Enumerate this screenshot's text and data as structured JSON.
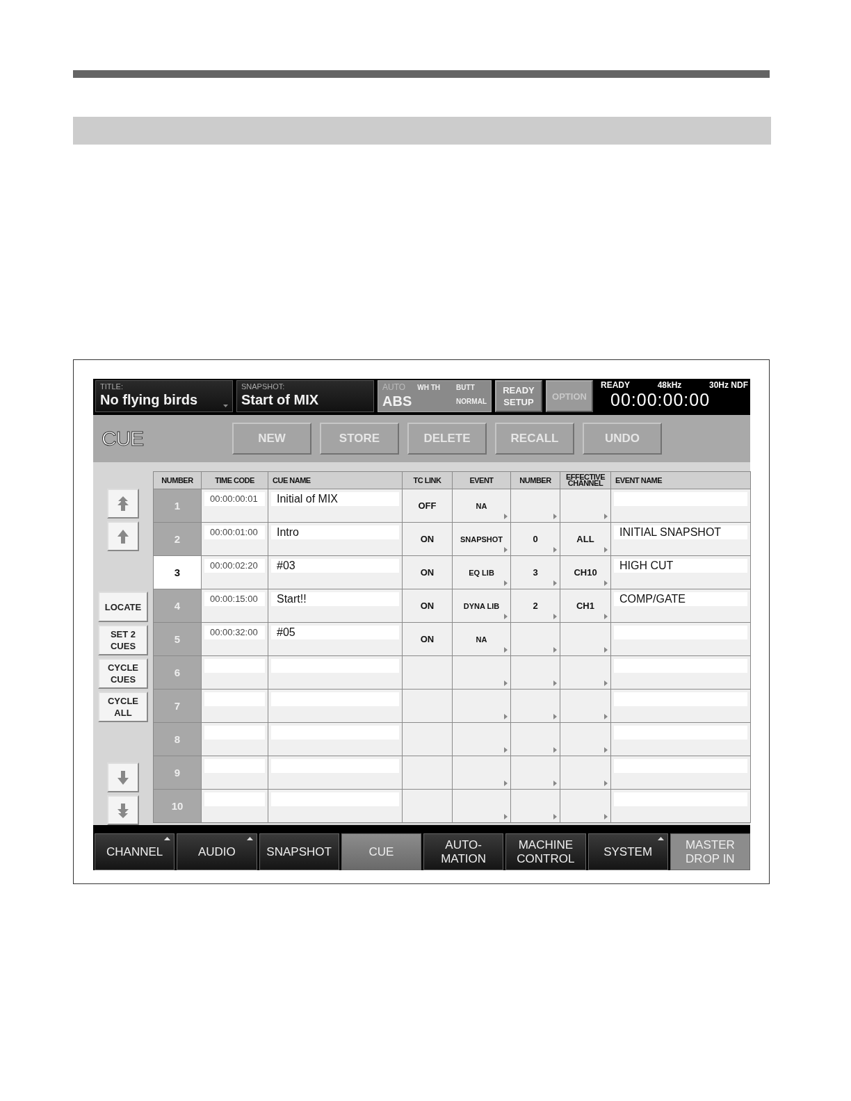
{
  "status_header": {
    "title": {
      "label": "TITLE:",
      "value": "No flying birds"
    },
    "snapshot": {
      "label": "SNAPSHOT:",
      "value": "Start of MIX"
    },
    "auto": {
      "label": "AUTO",
      "mode_1": "WH TH",
      "mode_2": "BUTT",
      "value": "ABS",
      "mode_3": "NORMAL"
    },
    "ready_setup": "READY\nSETUP",
    "option": {
      "label": "OPTION",
      "disabled": true
    },
    "status": {
      "state": "READY",
      "sample_rate": "48kHz",
      "frame_rate": "30Hz NDF",
      "timecode": "00:00:00:00"
    }
  },
  "toolbar": {
    "title": "CUE",
    "buttons": [
      "NEW",
      "STORE",
      "DELETE",
      "RECALL",
      "UNDO"
    ]
  },
  "side_buttons": [
    {
      "kind": "top"
    },
    {
      "kind": "up"
    },
    {
      "kind": "gap"
    },
    {
      "kind": "text",
      "label": "LOCATE"
    },
    {
      "kind": "text",
      "label": "SET 2\nCUES"
    },
    {
      "kind": "text",
      "label": "CYCLE\nCUES"
    },
    {
      "kind": "text",
      "label": "CYCLE\nALL"
    },
    {
      "kind": "gap"
    },
    {
      "kind": "down"
    },
    {
      "kind": "bottom"
    }
  ],
  "table": {
    "columns": [
      "NUMBER",
      "TIME CODE",
      "CUE NAME",
      "TC LINK",
      "EVENT",
      "NUMBER",
      "EFFECTIVE\nCHANNEL",
      "EVENT NAME"
    ],
    "rows": [
      {
        "number": "1",
        "selected": false,
        "time_code": "00:00:00:01",
        "cue_name": "Initial of MIX",
        "tc_link": "OFF",
        "event": "NA"
      },
      {
        "number": "2",
        "selected": false,
        "time_code": "00:00:01:00",
        "cue_name": "Intro",
        "tc_link": "ON",
        "event": "SNAPSHOT",
        "event_number": "0",
        "effective_channel": "ALL",
        "event_name": "INITIAL SNAPSHOT"
      },
      {
        "number": "3",
        "selected": true,
        "time_code": "00:00:02:20",
        "cue_name": "#03",
        "tc_link": "ON",
        "event": "EQ LIB",
        "event_number": "3",
        "effective_channel": "CH10",
        "event_name": "HIGH CUT"
      },
      {
        "number": "4",
        "selected": false,
        "time_code": "00:00:15:00",
        "cue_name": "Start!!",
        "tc_link": "ON",
        "event": "DYNA LIB",
        "event_number": "2",
        "effective_channel": "CH1",
        "event_name": "COMP/GATE"
      },
      {
        "number": "5",
        "selected": false,
        "time_code": "00:00:32:00",
        "cue_name": "#05",
        "tc_link": "ON",
        "event": "NA"
      },
      {
        "number": "6",
        "selected": false
      },
      {
        "number": "7",
        "selected": false
      },
      {
        "number": "8",
        "selected": false
      },
      {
        "number": "9",
        "selected": false
      },
      {
        "number": "10",
        "selected": false
      }
    ]
  },
  "tabs": [
    {
      "label": "CHANNEL",
      "selected": false,
      "has_menu": true
    },
    {
      "label": "AUDIO",
      "selected": false,
      "has_menu": true
    },
    {
      "label": "SNAPSHOT",
      "selected": false,
      "has_menu": false
    },
    {
      "label": "CUE",
      "selected": true,
      "has_menu": false
    },
    {
      "label": "AUTO-\nMATION",
      "selected": false,
      "has_menu": false
    },
    {
      "label": "MACHINE\nCONTROL",
      "selected": false,
      "has_menu": false
    },
    {
      "label": "SYSTEM",
      "selected": false,
      "has_menu": true
    },
    {
      "label": "MASTER\nDROP IN",
      "selected": false,
      "has_menu": false,
      "kind": "light"
    }
  ]
}
